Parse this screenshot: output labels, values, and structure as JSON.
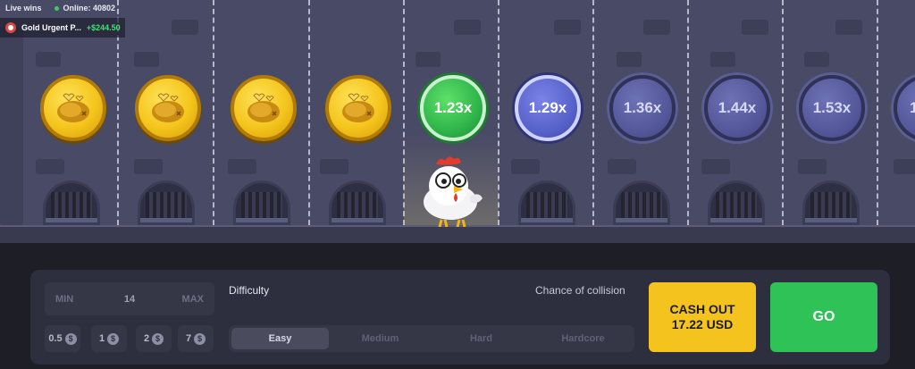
{
  "live_feed": {
    "live_wins_label": "Live wins",
    "online_label": "Online: 40802",
    "recent_win": {
      "player": "Gold Urgent P...",
      "amount": "+$244.50"
    }
  },
  "road": {
    "lanes": [
      {
        "state": "passed"
      },
      {
        "state": "passed"
      },
      {
        "state": "passed"
      },
      {
        "state": "passed"
      },
      {
        "state": "current",
        "multiplier": "1.23x"
      },
      {
        "state": "next",
        "multiplier": "1.29x"
      },
      {
        "state": "upcoming",
        "multiplier": "1.36x"
      },
      {
        "state": "upcoming",
        "multiplier": "1.44x"
      },
      {
        "state": "upcoming",
        "multiplier": "1.53x"
      },
      {
        "state": "upcoming",
        "multiplier": "1."
      }
    ],
    "passed_coin_icon": "roast-chicken-icon",
    "player_icon": "chicken-icon"
  },
  "controls": {
    "bet": {
      "min_label": "MIN",
      "value": "14",
      "max_label": "MAX"
    },
    "quick_bets": [
      {
        "label": "0.5",
        "icon": "dollar-coin-icon"
      },
      {
        "label": "1",
        "icon": "dollar-coin-icon"
      },
      {
        "label": "2",
        "icon": "dollar-coin-icon"
      },
      {
        "label": "7",
        "icon": "dollar-coin-icon"
      }
    ],
    "difficulty_label": "Difficulty",
    "chance_label": "Chance of collision",
    "difficulty_options": [
      "Easy",
      "Medium",
      "Hard",
      "Hardcore"
    ],
    "selected_difficulty": "Easy",
    "cashout": {
      "label": "CASH OUT",
      "amount": "17.22 USD"
    },
    "go_label": "GO"
  },
  "colors": {
    "gold": "#f4c51c",
    "active_green": "#2fc257",
    "cashout_yellow": "#f5c31d",
    "multiplier_blue": "#535799"
  }
}
